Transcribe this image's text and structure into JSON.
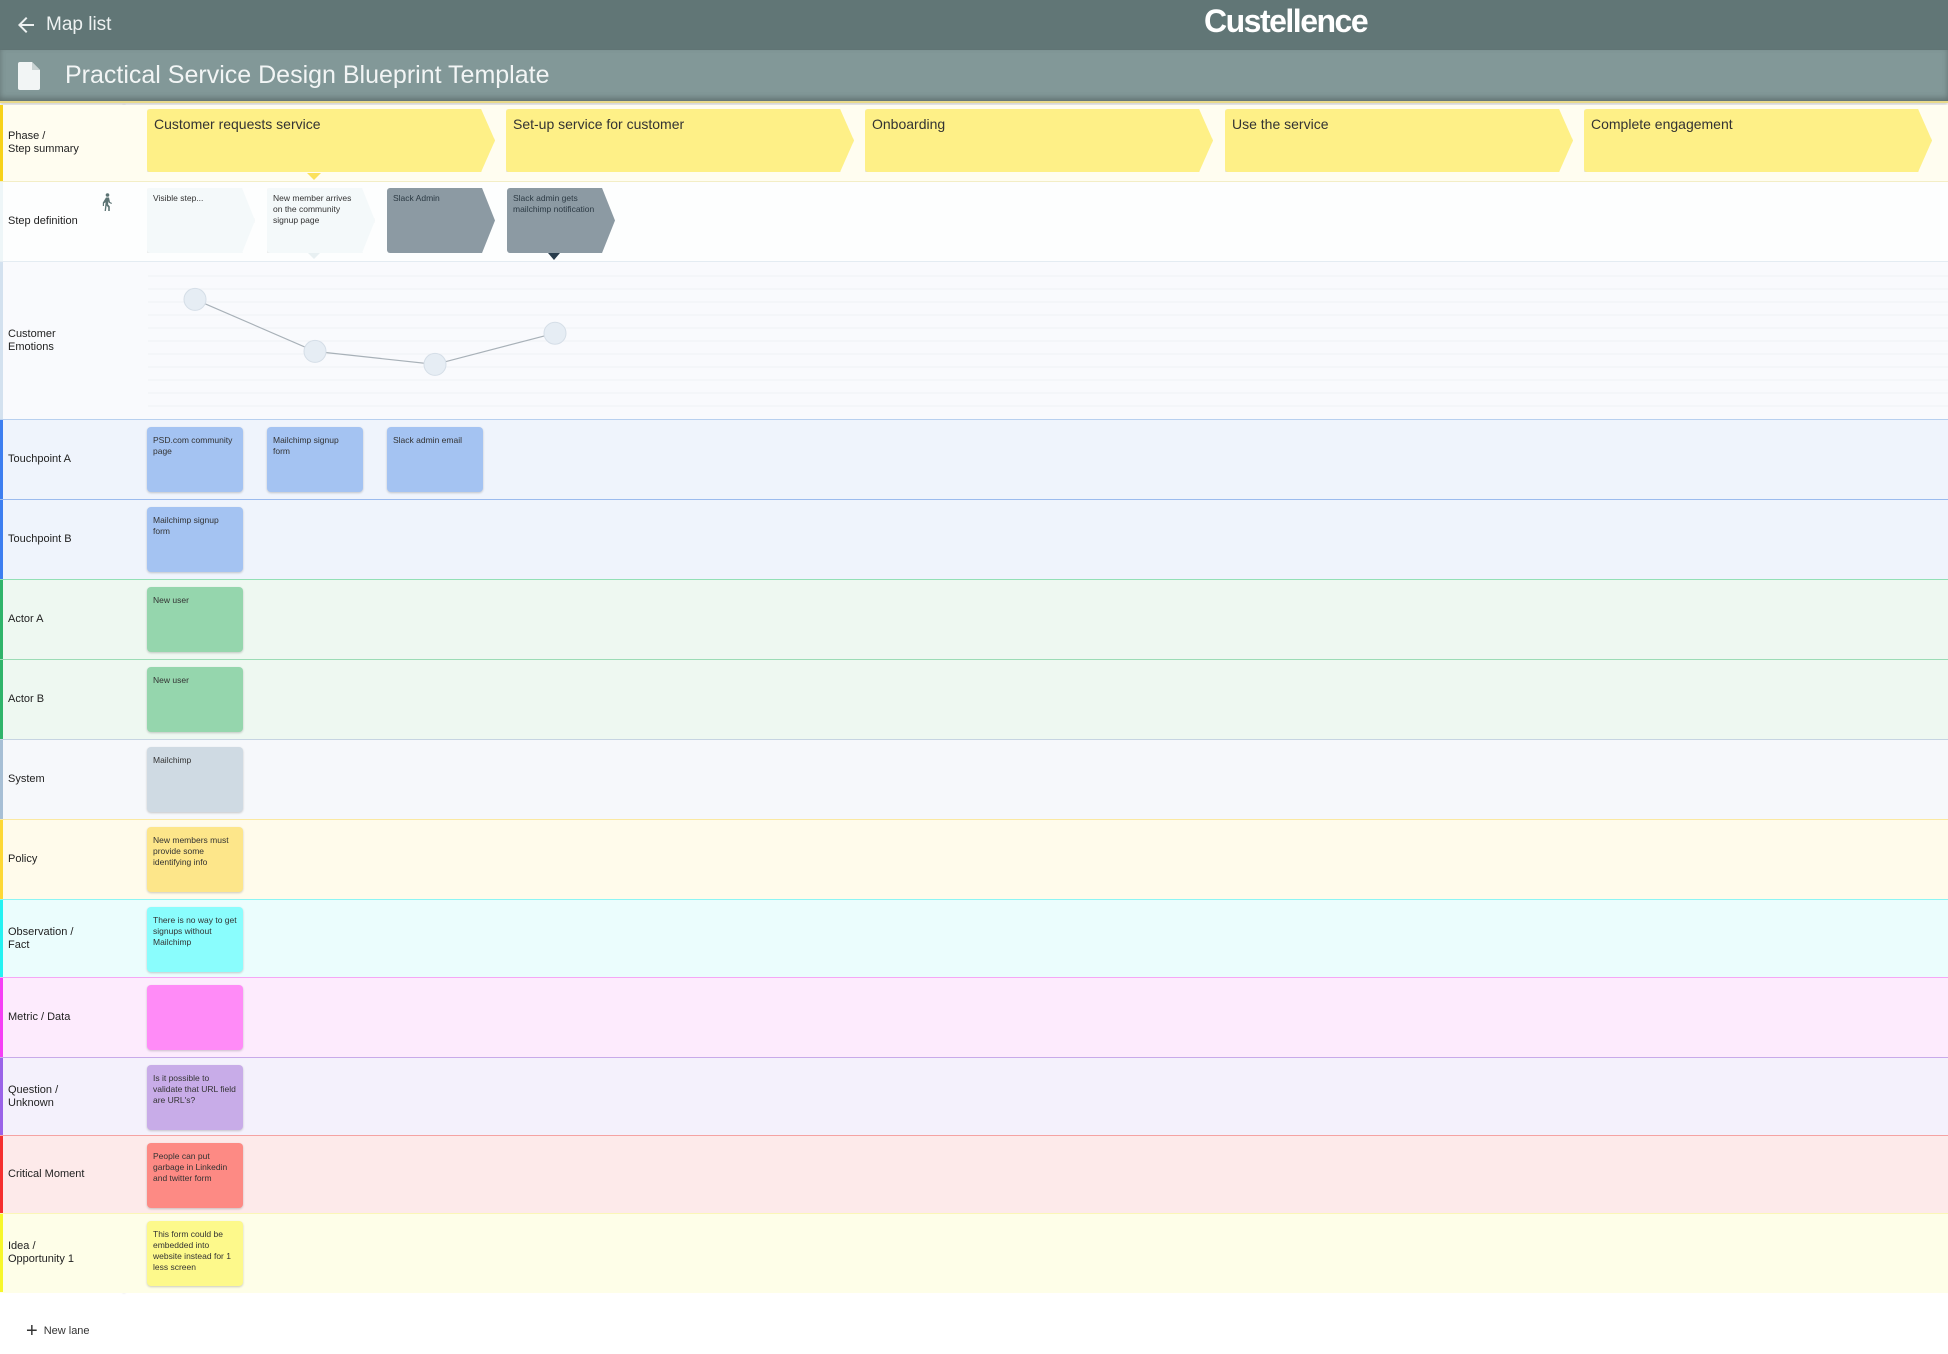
{
  "topbar": {
    "back_label": "Map list",
    "logo": "Custellence"
  },
  "titlebar": {
    "title": "Practical Service Design Blueprint Template"
  },
  "lanes": [
    {
      "id": "phase",
      "label": "Phase /\nStep summary",
      "accent": "#f7d21a",
      "bg": "#fffdf0",
      "border": "#f3eec6"
    },
    {
      "id": "steps",
      "label": "Step definition",
      "accent": "#eef6f8",
      "bg": "#fdfefe",
      "border": "#e4ecf2"
    },
    {
      "id": "emotions",
      "label": "Customer\nEmotions",
      "accent": "#d3e1ef",
      "bg": "#f9fafd",
      "border": "#b8d0ef"
    },
    {
      "id": "touchpoint-a",
      "label": "Touchpoint A",
      "accent": "#3d7ef0",
      "bg": "#eff4fc",
      "border": "#9bbbee"
    },
    {
      "id": "touchpoint-b",
      "label": "Touchpoint B",
      "accent": "#3d7ef0",
      "bg": "#eff4fc",
      "border": "#93e0b5"
    },
    {
      "id": "actor-a",
      "label": "Actor A",
      "accent": "#2fb46a",
      "bg": "#eef8f1",
      "border": "#9cdcb6"
    },
    {
      "id": "actor-b",
      "label": "Actor B",
      "accent": "#2fb46a",
      "bg": "#eef8f1",
      "border": "#c6d4e2"
    },
    {
      "id": "system",
      "label": "System",
      "accent": "#a7bfd5",
      "bg": "#f6f8fb",
      "border": "#fbe9a1"
    },
    {
      "id": "policy",
      "label": "Policy",
      "accent": "#fdd835",
      "bg": "#fffbeb",
      "border": "#8cf5f5"
    },
    {
      "id": "observation",
      "label": "Observation /\nFact",
      "accent": "#25f2f2",
      "bg": "#ebfdfd",
      "border": "#f5a7f5"
    },
    {
      "id": "metric",
      "label": "Metric / Data",
      "accent": "#f53ff5",
      "bg": "#fdebfd",
      "border": "#c8aaea"
    },
    {
      "id": "question",
      "label": "Question /\nUnknown",
      "accent": "#9a63e8",
      "bg": "#f4f1fc",
      "border": "#f5a3a3"
    },
    {
      "id": "critical",
      "label": "Critical Moment",
      "accent": "#f52f2f",
      "bg": "#fdeaea",
      "border": "#fbf6b8"
    },
    {
      "id": "idea",
      "label": "Idea /\nOpportunity 1",
      "accent": "#f7f72a",
      "bg": "#fefee8",
      "border": "#fefee8"
    }
  ],
  "phases": [
    {
      "label": "Customer requests service"
    },
    {
      "label": "Set-up service for customer"
    },
    {
      "label": "Onboarding"
    },
    {
      "label": "Use the service"
    },
    {
      "label": "Complete engagement"
    }
  ],
  "steps": [
    {
      "label": "Visible step...",
      "style": "light"
    },
    {
      "label": "New member arrives on the community signup page",
      "style": "light"
    },
    {
      "label": "Slack Admin",
      "style": "dark"
    },
    {
      "label": "Slack admin gets mailchimp notification",
      "style": "dark"
    }
  ],
  "emotions": {
    "scale": "1 (low) to 10 (high)",
    "values": [
      8.2,
      4.2,
      3.2,
      5.6
    ]
  },
  "cards": {
    "touchpoint-a": [
      {
        "col": 0,
        "text": "PSD.com community page",
        "color": "#a4c3f2"
      },
      {
        "col": 1,
        "text": "Mailchimp signup form",
        "color": "#a4c3f2"
      },
      {
        "col": 2,
        "text": "Slack admin email",
        "color": "#a4c3f2"
      }
    ],
    "touchpoint-b": [
      {
        "col": 0,
        "text": "Mailchimp signup form",
        "color": "#a4c3f2"
      }
    ],
    "actor-a": [
      {
        "col": 0,
        "text": "New user",
        "color": "#95d6ad"
      }
    ],
    "actor-b": [
      {
        "col": 0,
        "text": "New user",
        "color": "#95d6ad"
      }
    ],
    "system": [
      {
        "col": 0,
        "text": "Mailchimp",
        "color": "#cfdae3"
      }
    ],
    "policy": [
      {
        "col": 0,
        "text": "New members must provide some identifying info",
        "color": "#fde68a"
      }
    ],
    "observation": [
      {
        "col": 0,
        "text": "There is no way to get signups without Mailchimp",
        "color": "#8afdfd"
      }
    ],
    "metric": [
      {
        "col": 0,
        "text": "",
        "color": "#ff8bf7"
      }
    ],
    "question": [
      {
        "col": 0,
        "text": "Is it possible to validate that URL field are URL's?",
        "color": "#c8ace8"
      }
    ],
    "critical": [
      {
        "col": 0,
        "text": "People can put garbage in Linkedin and twitter form",
        "color": "#fd8a84"
      }
    ],
    "idea": [
      {
        "col": 0,
        "text": "This form could be embedded into website instead for 1 less screen",
        "color": "#fdf98b"
      }
    ]
  },
  "footer": {
    "new_lane_label": "New lane"
  }
}
